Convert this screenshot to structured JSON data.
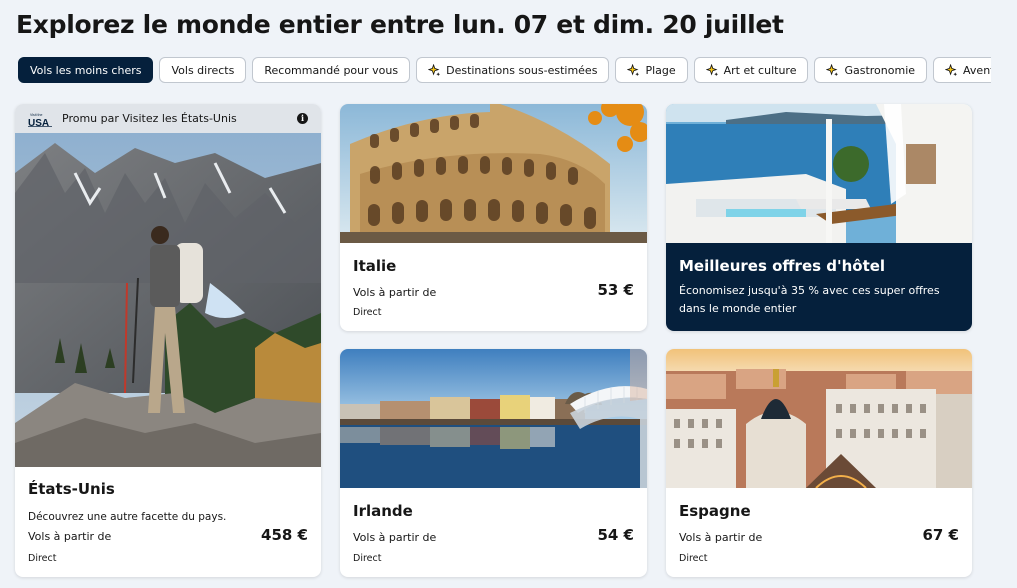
{
  "page": {
    "title": "Explorez le monde entier entre lun. 07 et dim. 20 juillet"
  },
  "filters": [
    {
      "label": "Vols les moins chers",
      "active": true,
      "icon": null
    },
    {
      "label": "Vols directs",
      "active": false,
      "icon": null
    },
    {
      "label": "Recommandé pour vous",
      "active": false,
      "icon": null
    },
    {
      "label": "Destinations sous-estimées",
      "active": false,
      "icon": "sparkle-icon"
    },
    {
      "label": "Plage",
      "active": false,
      "icon": "sparkle-icon"
    },
    {
      "label": "Art et culture",
      "active": false,
      "icon": "sparkle-icon"
    },
    {
      "label": "Gastronomie",
      "active": false,
      "icon": "sparkle-icon"
    },
    {
      "label": "Aventures en plein",
      "active": false,
      "icon": "sparkle-icon"
    }
  ],
  "promo": {
    "sponsor": "Promu par Visitez les États-Unis",
    "logo_text": "USA",
    "name": "États-Unis",
    "subtitle": "Découvrez une autre facette du pays.",
    "from_label": "Vols à partir de",
    "price": "458 €",
    "direct_label": "Direct",
    "info_icon": "info-icon"
  },
  "destinations": [
    {
      "id": "italie",
      "name": "Italie",
      "from_label": "Vols à partir de",
      "price": "53 €",
      "direct_label": "Direct"
    },
    {
      "id": "irlande",
      "name": "Irlande",
      "from_label": "Vols à partir de",
      "price": "54 €",
      "direct_label": "Direct"
    },
    {
      "id": "espagne",
      "name": "Espagne",
      "from_label": "Vols à partir de",
      "price": "67 €",
      "direct_label": "Direct"
    }
  ],
  "hotel": {
    "title": "Meilleures offres d'hôtel",
    "description": "Économisez jusqu'à 35 % avec ces super offres dans le monde entier"
  },
  "colors": {
    "background": "#eff3f8",
    "active_chip": "#05203c",
    "hotel_panel": "#05203c",
    "sparkle": "#f5c419"
  }
}
